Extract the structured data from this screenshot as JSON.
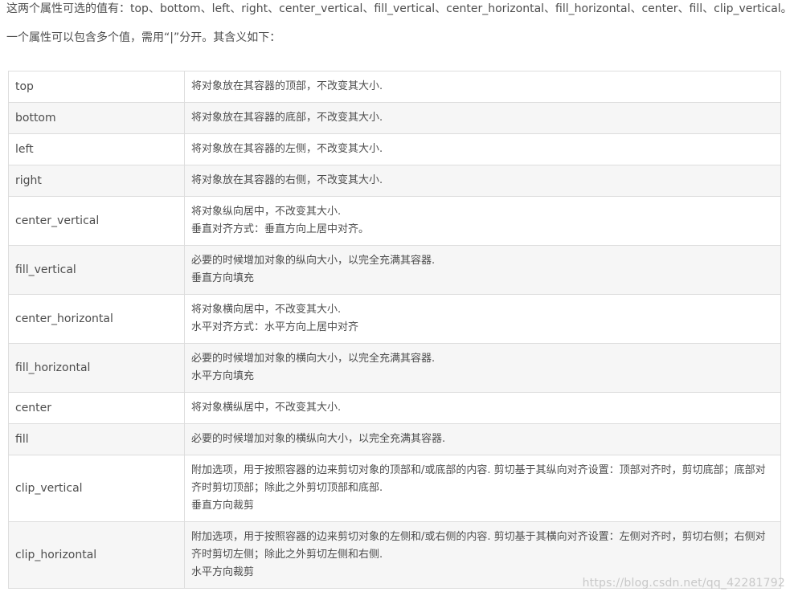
{
  "intro": {
    "line1": "这两个属性可选的值有：top、bottom、left、right、center_vertical、fill_vertical、center_horizontal、fill_horizontal、center、fill、clip_vertical。",
    "line2": "一个属性可以包含多个值，需用“|”分开。其含义如下："
  },
  "table": {
    "rows": [
      {
        "name": "top",
        "desc": [
          "将对象放在其容器的顶部，不改变其大小."
        ]
      },
      {
        "name": "bottom",
        "desc": [
          "将对象放在其容器的底部，不改变其大小."
        ]
      },
      {
        "name": "left",
        "desc": [
          "将对象放在其容器的左侧，不改变其大小."
        ]
      },
      {
        "name": "right",
        "desc": [
          "将对象放在其容器的右侧，不改变其大小."
        ]
      },
      {
        "name": "center_vertical",
        "desc": [
          "将对象纵向居中，不改变其大小.",
          "垂直对齐方式：垂直方向上居中对齐。"
        ]
      },
      {
        "name": "fill_vertical",
        "desc": [
          "必要的时候增加对象的纵向大小，以完全充满其容器.",
          "垂直方向填充"
        ]
      },
      {
        "name": "center_horizontal",
        "desc": [
          "将对象横向居中，不改变其大小.",
          "水平对齐方式：水平方向上居中对齐"
        ]
      },
      {
        "name": "fill_horizontal",
        "desc": [
          "必要的时候增加对象的横向大小，以完全充满其容器.",
          "水平方向填充"
        ]
      },
      {
        "name": "center",
        "desc": [
          "将对象横纵居中，不改变其大小."
        ]
      },
      {
        "name": "fill",
        "desc": [
          "必要的时候增加对象的横纵向大小，以完全充满其容器."
        ]
      },
      {
        "name": "clip_vertical",
        "desc": [
          "附加选项，用于按照容器的边来剪切对象的顶部和/或底部的内容. 剪切基于其纵向对齐设置：顶部对齐时，剪切底部；底部对齐时剪切顶部；除此之外剪切顶部和底部.",
          "垂直方向裁剪"
        ]
      },
      {
        "name": "clip_horizontal",
        "desc": [
          "附加选项，用于按照容器的边来剪切对象的左侧和/或右侧的内容. 剪切基于其横向对齐设置：左侧对齐时，剪切右侧；右侧对齐时剪切左侧；除此之外剪切左侧和右侧.",
          "水平方向裁剪"
        ]
      }
    ]
  },
  "watermark": "https://blog.csdn.net/qq_42281792"
}
